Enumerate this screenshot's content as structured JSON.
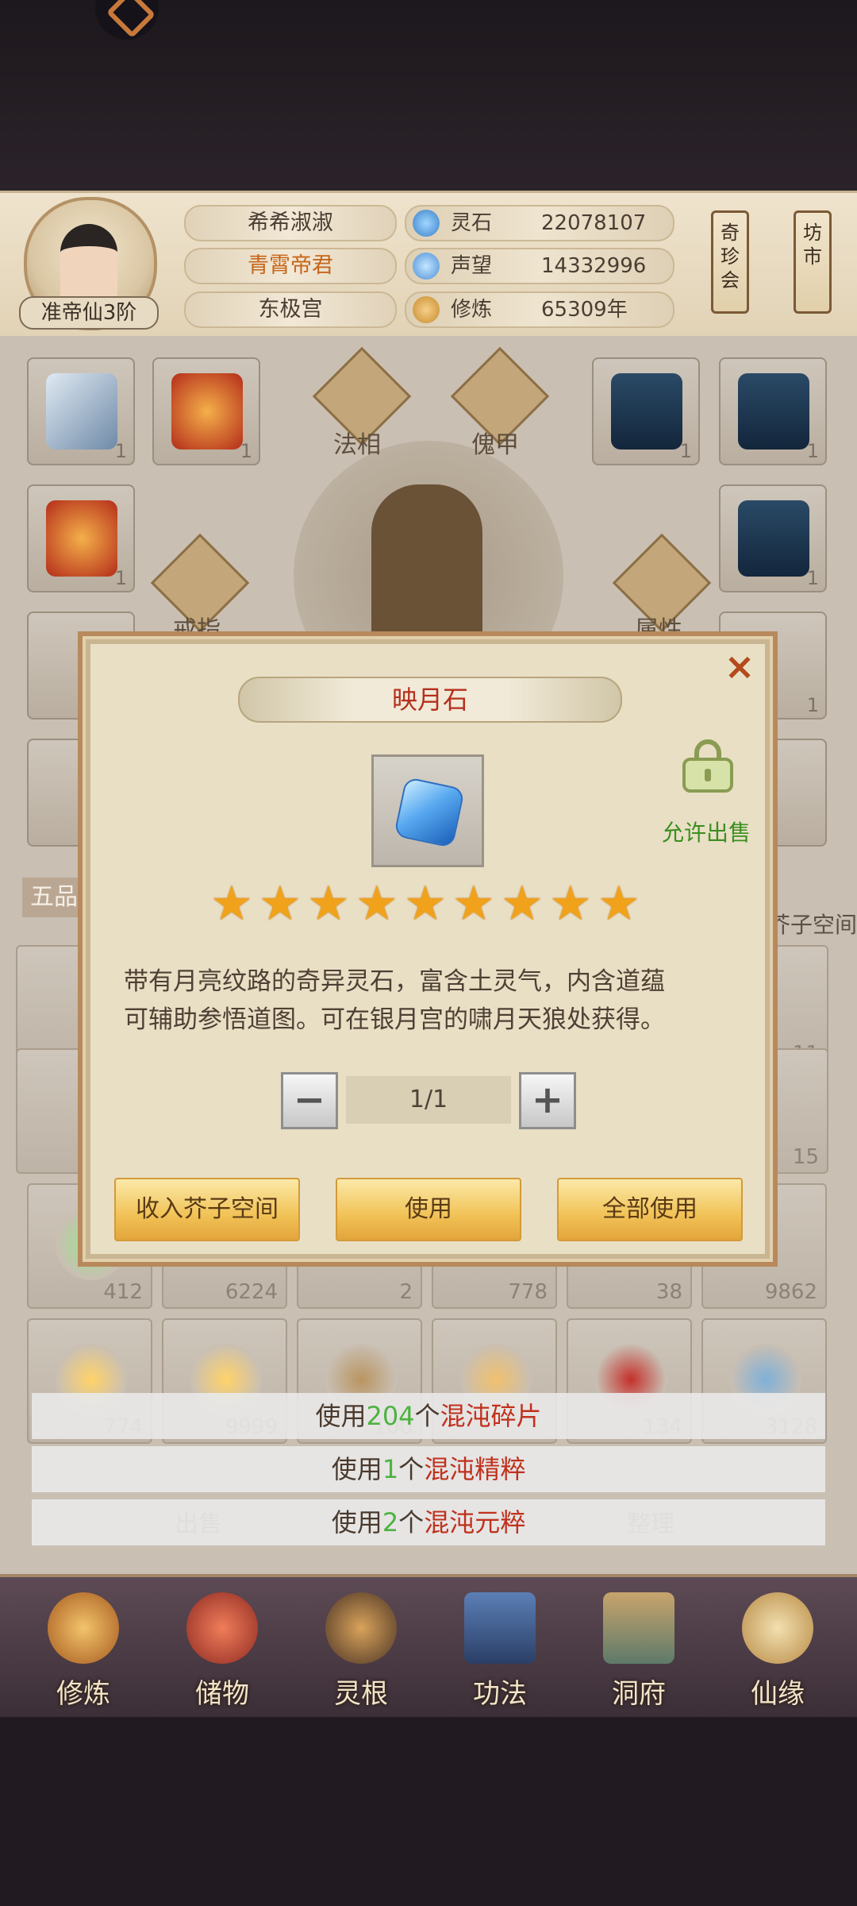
{
  "player": {
    "name": "希希淑淑",
    "title": "青霄帝君",
    "sect": "东极宫",
    "rank": "准帝仙3阶"
  },
  "stats": [
    {
      "label": "灵石",
      "value": "22078107",
      "icon": "spirit-stone-icon"
    },
    {
      "label": "声望",
      "value": "14332996",
      "icon": "prestige-icon"
    },
    {
      "label": "修炼",
      "value": "65309年",
      "icon": "cultivation-icon"
    }
  ],
  "side_buttons": {
    "treasure": "奇珍会",
    "market": "坊市"
  },
  "equipment": {
    "slot_counts": [
      "1",
      "1",
      "1",
      "1",
      "1",
      "1",
      "1",
      "1"
    ],
    "labels": {
      "faxiang": "法相",
      "kuijia": "傀甲",
      "jiezhi": "戒指",
      "shuxing": "属性"
    }
  },
  "bag": {
    "tab": "五品",
    "storage": "芥子空间",
    "counts_row1": [
      "11"
    ],
    "counts_row2": [
      "15"
    ],
    "counts_row3": [
      "412",
      "6224",
      "2",
      "778",
      "38",
      "9862"
    ],
    "counts_row4": [
      "774",
      "9999",
      "100",
      "—",
      "134",
      "3128"
    ]
  },
  "bottom_buttons": {
    "sell": "出售",
    "sort": "整理"
  },
  "nav": [
    {
      "label": "修炼",
      "icon": "cultivate-icon"
    },
    {
      "label": "储物",
      "icon": "storage-bag-icon"
    },
    {
      "label": "灵根",
      "icon": "spirit-root-icon"
    },
    {
      "label": "功法",
      "icon": "technique-book-icon"
    },
    {
      "label": "洞府",
      "icon": "cave-house-icon"
    },
    {
      "label": "仙缘",
      "icon": "gourd-icon"
    }
  ],
  "modal": {
    "title": "映月石",
    "stars": 9,
    "sale_status": "允许出售",
    "description_line1": "带有月亮纹路的奇异灵石，富含土灵气，内含道蕴",
    "description_line2": "可辅助参悟道图。可在银月宫的啸月天狼处获得。",
    "quantity": "1/1",
    "buttons": {
      "store": "收入芥子空间",
      "use": "使用",
      "use_all": "全部使用"
    }
  },
  "usage": [
    {
      "prefix": "使用",
      "count": "204",
      "mid": "个",
      "item": "混沌碎片"
    },
    {
      "prefix": "使用",
      "count": "1",
      "mid": "个",
      "item": "混沌精粹"
    },
    {
      "prefix": "使用",
      "count": "2",
      "mid": "个",
      "item": "混沌元粹"
    }
  ],
  "colors": {
    "title_red": "#b5301d",
    "allow_green": "#3a8f1f",
    "count_green": "#4db33f",
    "button_gold": "#f1c256"
  }
}
